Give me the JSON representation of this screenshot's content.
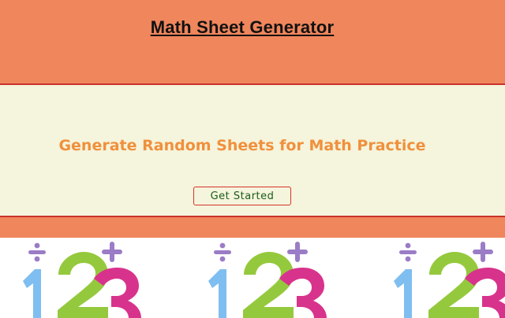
{
  "header": {
    "title": "Math Sheet Generator"
  },
  "hero": {
    "heading": "Generate Random Sheets for Math Practice",
    "button_label": "Get Started"
  },
  "banner": {
    "tiles": [
      {
        "name": "numbers-tile-1",
        "digits": [
          "1",
          "2",
          "3"
        ],
        "symbols": [
          "÷",
          "+"
        ]
      },
      {
        "name": "numbers-tile-2",
        "digits": [
          "1",
          "2",
          "3"
        ],
        "symbols": [
          "÷",
          "+"
        ]
      },
      {
        "name": "numbers-tile-3",
        "digits": [
          "1",
          "2",
          "3"
        ],
        "symbols": [
          "÷",
          "+"
        ]
      }
    ]
  },
  "colors": {
    "header_bg": "#f0865c",
    "hero_bg": "#f5f4dc",
    "heading_color": "#f0903c",
    "border_accent": "#c9322a",
    "digit_one": "#7fbef0",
    "digit_two": "#95c93d",
    "digit_three": "#d8338c",
    "symbol_color": "#9b7cc6"
  }
}
